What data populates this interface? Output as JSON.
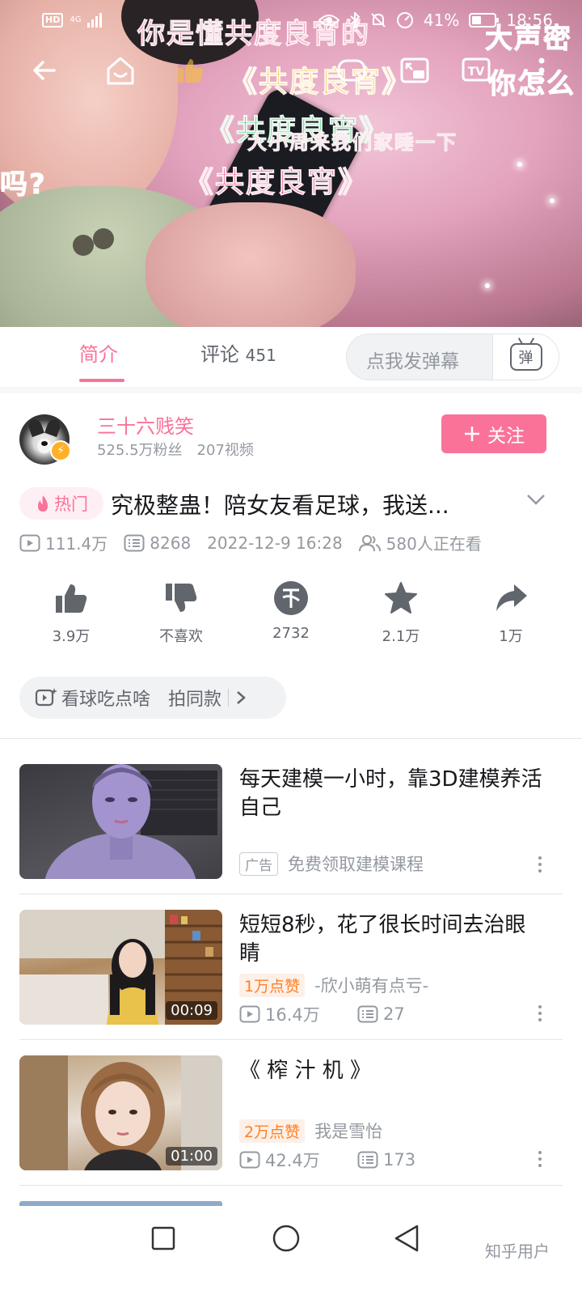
{
  "status_bar": {
    "hd": "HD",
    "network": "4G",
    "battery_percent": "41%",
    "battery_level": 0.41,
    "time": "18:56"
  },
  "player": {
    "danmaku": [
      {
        "text": "你是懂共度良宵的",
        "color": "#e84a7a"
      },
      {
        "text": "《共度良宵》",
        "color": "#f7c23b"
      },
      {
        "text": "《共度良宵》",
        "color": "#33c46b"
      },
      {
        "text": "大小周来我们家睡一下",
        "color": "#d02b54"
      },
      {
        "text": "《共度良宵》",
        "color": "#e63d7e"
      },
      {
        "text": "大声密",
        "color": "#ffffff"
      },
      {
        "text": "你怎么",
        "color": "#ffffff"
      },
      {
        "text": "吗?",
        "color": "#ffffff"
      }
    ],
    "icons": [
      "back-arrow-icon",
      "home-icon",
      "like-outline-icon",
      "pip-icon",
      "tv-cast-icon",
      "more-icon"
    ]
  },
  "tabs": {
    "intro_label": "简介",
    "comments_label": "评论",
    "comments_count": "451",
    "danmaku_placeholder": "点我发弹幕",
    "danmaku_button": "弹"
  },
  "uploader": {
    "name": "三十六贱笑",
    "followers": "525.5万粉丝",
    "videos": "207视频",
    "follow_label": "关注"
  },
  "video": {
    "hot_label": "热门",
    "title": "究极整蛊！陪女友看足球，我送...",
    "views": "111.4万",
    "danmaku_count": "8268",
    "date": "2022-12-9 16:28",
    "watching": "580人正在看"
  },
  "actions": [
    {
      "icon": "thumbs-up-icon",
      "label": "3.9万"
    },
    {
      "icon": "thumbs-down-icon",
      "label": "不喜欢"
    },
    {
      "icon": "coin-icon",
      "label": "2732"
    },
    {
      "icon": "star-icon",
      "label": "2.1万"
    },
    {
      "icon": "share-icon",
      "label": "1万"
    }
  ],
  "tag_chip": {
    "label": "看球吃点啥",
    "action": "拍同款"
  },
  "recommendations": [
    {
      "title": "每天建模一小时，靠3D建模养活自己",
      "ad_label": "广告",
      "subtitle": "免费领取建模课程"
    },
    {
      "title": "短短8秒，花了很长时间去治眼睛",
      "like_badge": "1万点赞",
      "author": "-欣小萌有点亏-",
      "views": "16.4万",
      "danmaku": "27",
      "duration": "00:09"
    },
    {
      "title": "《 榨 汁 机 》",
      "like_badge": "2万点赞",
      "author": "我是雪怡",
      "views": "42.4万",
      "danmaku": "173",
      "duration": "01:00"
    }
  ],
  "watermark": "知乎用户",
  "colors": {
    "accent": "#fb7299",
    "secondary_text": "#9499a0",
    "primary_text": "#18191c"
  }
}
